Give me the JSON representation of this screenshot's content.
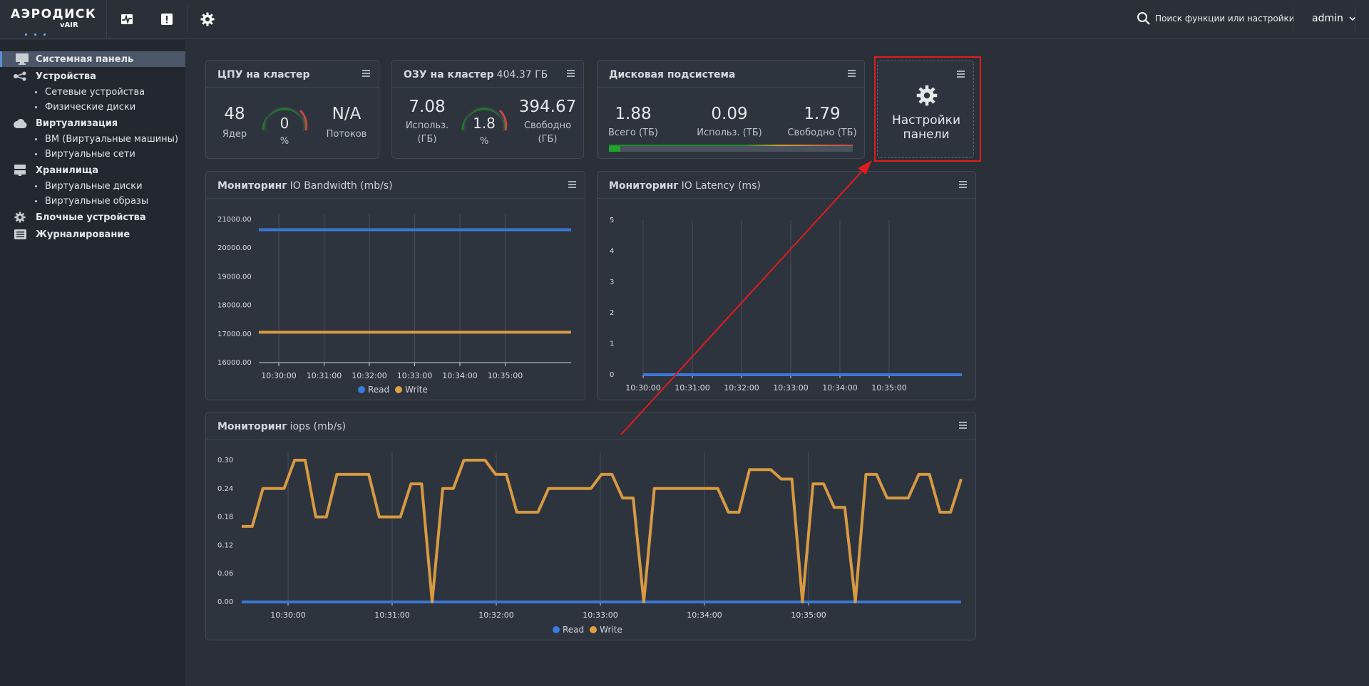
{
  "header": {
    "logo_main": "АЭРОДИСК",
    "logo_sub": "vAIR",
    "search_placeholder": "Поиск функции или настройки",
    "user": "admin"
  },
  "sidebar": {
    "items": [
      {
        "label": "Системная панель",
        "icon": "monitor-icon",
        "active": true
      },
      {
        "label": "Устройства",
        "icon": "devices-icon"
      },
      {
        "label": "Сетевые устройства",
        "sub": true
      },
      {
        "label": "Физические диски",
        "sub": true
      },
      {
        "label": "Виртуализация",
        "icon": "cloud-icon"
      },
      {
        "label": "ВМ (Виртуальные машины)",
        "sub": true
      },
      {
        "label": "Виртуальные сети",
        "sub": true
      },
      {
        "label": "Хранилища",
        "icon": "storage-icon"
      },
      {
        "label": "Виртуальные диски",
        "sub": true
      },
      {
        "label": "Виртуальные образы",
        "sub": true
      },
      {
        "label": "Блочные устройства",
        "icon": "gear-icon"
      },
      {
        "label": "Журналирование",
        "icon": "log-icon"
      }
    ]
  },
  "cpu": {
    "title": "ЦПУ на кластер",
    "cores": "48",
    "cores_label": "Ядер",
    "gauge_value": "0",
    "gauge_unit": "%",
    "threads": "N/A",
    "threads_label": "Потоков"
  },
  "ram": {
    "title": "ОЗУ на кластер",
    "total": "404.37 ГБ",
    "used": "7.08",
    "used_label_1": "Использ.",
    "used_label_2": "(ГБ)",
    "gauge_value": "1.8",
    "gauge_unit": "%",
    "free": "394.67",
    "free_label_1": "Свободно",
    "free_label_2": "(ГБ)"
  },
  "disk": {
    "title": "Дисковая подсистема",
    "total": "1.88",
    "total_label": "Всего (ТБ)",
    "used": "0.09",
    "used_label": "Использ. (ТБ)",
    "free": "1.79",
    "free_label": "Свободно (ТБ)",
    "usage_fraction": 0.048
  },
  "settings_panel": {
    "label_1": "Настройки",
    "label_2": "панели"
  },
  "colors": {
    "read": "#3a7be0",
    "write": "#e0a042",
    "highlight": "#e21b1b"
  },
  "legend": {
    "read": "Read",
    "write": "Write"
  },
  "chart_data": [
    {
      "type": "line",
      "title": "Мониторинг",
      "subtitle": "IO Bandwidth (mb/s)",
      "x_ticks": [
        "10:30:00",
        "10:31:00",
        "10:32:00",
        "10:33:00",
        "10:34:00",
        "10:35:00"
      ],
      "y_ticks": [
        "21000.00",
        "20000.00",
        "19000.00",
        "18000.00",
        "17000.00",
        "16000.00"
      ],
      "ylim": [
        16000,
        21000
      ],
      "series": [
        {
          "name": "Read",
          "values": [
            20640,
            20640
          ]
        },
        {
          "name": "Write",
          "values": [
            17060,
            17060
          ]
        }
      ]
    },
    {
      "type": "line",
      "title": "Мониторинг",
      "subtitle": "IO Latency (ms)",
      "x_ticks": [
        "10:30:00",
        "10:31:00",
        "10:32:00",
        "10:33:00",
        "10:34:00",
        "10:35:00"
      ],
      "y_ticks": [
        "5",
        "4",
        "3",
        "2",
        "1",
        "0"
      ],
      "ylim": [
        0,
        5
      ],
      "series": [
        {
          "name": "Read",
          "values": [
            0.0,
            0.0
          ]
        }
      ]
    },
    {
      "type": "line",
      "title": "Мониторинг",
      "subtitle": "iops (mb/s)",
      "x_ticks": [
        "10:30:00",
        "10:31:00",
        "10:32:00",
        "10:33:00",
        "10:34:00",
        "10:35:00"
      ],
      "y_ticks": [
        "0.30",
        "0.24",
        "0.18",
        "0.12",
        "0.06",
        "0.00"
      ],
      "ylim": [
        0,
        0.3
      ],
      "series": [
        {
          "name": "Read",
          "values": [
            0,
            0
          ]
        },
        {
          "name": "Write",
          "values": [
            0.16,
            0.16,
            0.24,
            0.24,
            0.24,
            0.3,
            0.3,
            0.18,
            0.18,
            0.27,
            0.27,
            0.27,
            0.27,
            0.18,
            0.18,
            0.18,
            0.25,
            0.25,
            0.0,
            0.24,
            0.24,
            0.3,
            0.3,
            0.3,
            0.27,
            0.27,
            0.19,
            0.19,
            0.19,
            0.24,
            0.24,
            0.24,
            0.24,
            0.24,
            0.27,
            0.27,
            0.22,
            0.22,
            0.0,
            0.24,
            0.24,
            0.24,
            0.24,
            0.24,
            0.24,
            0.24,
            0.19,
            0.19,
            0.28,
            0.28,
            0.28,
            0.26,
            0.26,
            0.0,
            0.25,
            0.25,
            0.2,
            0.2,
            0.0,
            0.27,
            0.27,
            0.22,
            0.22,
            0.22,
            0.27,
            0.27,
            0.19,
            0.19,
            0.26
          ]
        }
      ]
    }
  ]
}
